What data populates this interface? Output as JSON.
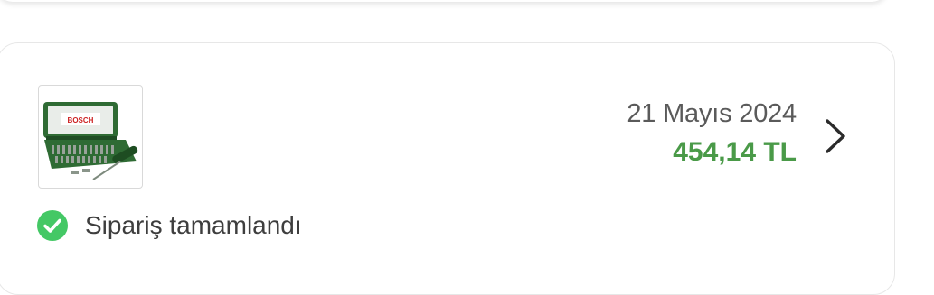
{
  "order": {
    "date": "21 Mayıs 2024",
    "price": "454,14 TL",
    "status": "Sipariş tamamlandı",
    "product_brand": "BOSCH",
    "colors": {
      "price": "#4a9a48",
      "status_check": "#44c865",
      "product_case": "#2f6b34"
    },
    "icons": {
      "status": "check-circle-icon",
      "navigate": "chevron-right-icon"
    }
  }
}
